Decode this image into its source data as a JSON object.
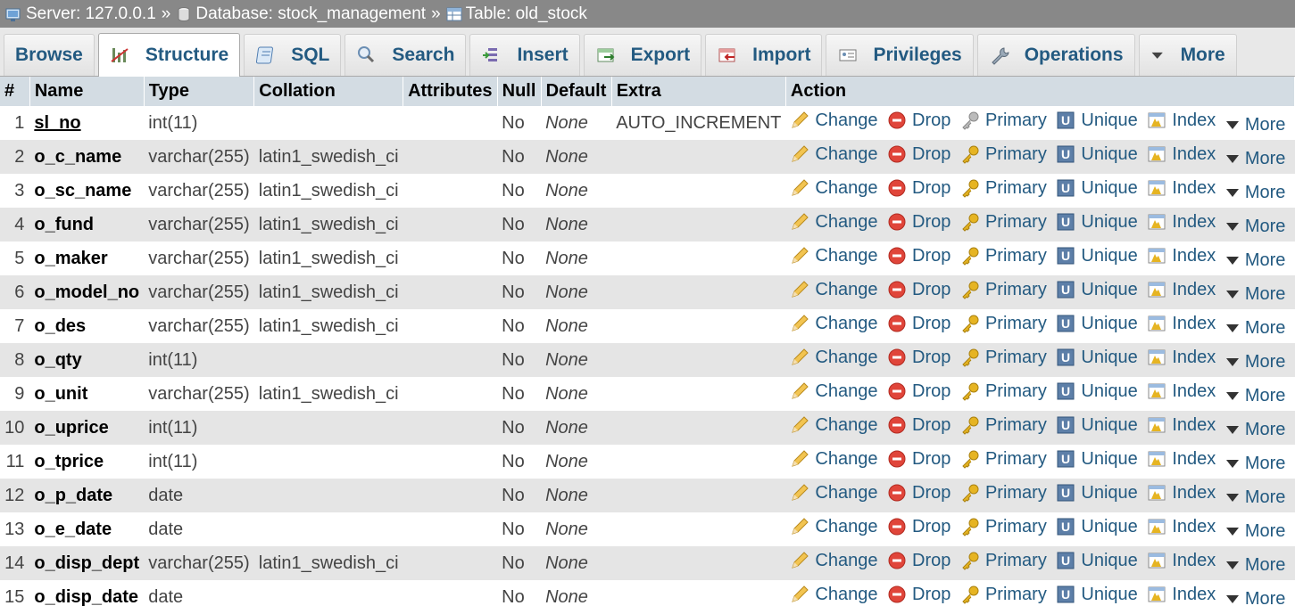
{
  "breadcrumb": {
    "server": "Server: 127.0.0.1",
    "database": "Database: stock_management",
    "table": "Table: old_stock",
    "separator": "»"
  },
  "tabs": [
    {
      "label": "Browse",
      "icon": "browse-icon"
    },
    {
      "label": "Structure",
      "icon": "structure-icon"
    },
    {
      "label": "SQL",
      "icon": "sql-icon"
    },
    {
      "label": "Search",
      "icon": "search-icon"
    },
    {
      "label": "Insert",
      "icon": "insert-icon"
    },
    {
      "label": "Export",
      "icon": "export-icon"
    },
    {
      "label": "Import",
      "icon": "import-icon"
    },
    {
      "label": "Privileges",
      "icon": "privileges-icon"
    },
    {
      "label": "Operations",
      "icon": "wrench-icon"
    },
    {
      "label": "More",
      "icon": "dropdown-icon"
    }
  ],
  "active_tab": "Structure",
  "columns": [
    "#",
    "Name",
    "Type",
    "Collation",
    "Attributes",
    "Null",
    "Default",
    "Extra",
    "Action"
  ],
  "actions": {
    "change": "Change",
    "drop": "Drop",
    "primary": "Primary",
    "unique": "Unique",
    "index": "Index",
    "more": "More"
  },
  "rows": [
    {
      "num": "1",
      "name": "sl_no",
      "type": "int(11)",
      "collation": "",
      "attributes": "",
      "null": "No",
      "default": "None",
      "extra": "AUTO_INCREMENT"
    },
    {
      "num": "2",
      "name": "o_c_name",
      "type": "varchar(255)",
      "collation": "latin1_swedish_ci",
      "attributes": "",
      "null": "No",
      "default": "None",
      "extra": ""
    },
    {
      "num": "3",
      "name": "o_sc_name",
      "type": "varchar(255)",
      "collation": "latin1_swedish_ci",
      "attributes": "",
      "null": "No",
      "default": "None",
      "extra": ""
    },
    {
      "num": "4",
      "name": "o_fund",
      "type": "varchar(255)",
      "collation": "latin1_swedish_ci",
      "attributes": "",
      "null": "No",
      "default": "None",
      "extra": ""
    },
    {
      "num": "5",
      "name": "o_maker",
      "type": "varchar(255)",
      "collation": "latin1_swedish_ci",
      "attributes": "",
      "null": "No",
      "default": "None",
      "extra": ""
    },
    {
      "num": "6",
      "name": "o_model_no",
      "type": "varchar(255)",
      "collation": "latin1_swedish_ci",
      "attributes": "",
      "null": "No",
      "default": "None",
      "extra": ""
    },
    {
      "num": "7",
      "name": "o_des",
      "type": "varchar(255)",
      "collation": "latin1_swedish_ci",
      "attributes": "",
      "null": "No",
      "default": "None",
      "extra": ""
    },
    {
      "num": "8",
      "name": "o_qty",
      "type": "int(11)",
      "collation": "",
      "attributes": "",
      "null": "No",
      "default": "None",
      "extra": ""
    },
    {
      "num": "9",
      "name": "o_unit",
      "type": "varchar(255)",
      "collation": "latin1_swedish_ci",
      "attributes": "",
      "null": "No",
      "default": "None",
      "extra": ""
    },
    {
      "num": "10",
      "name": "o_uprice",
      "type": "int(11)",
      "collation": "",
      "attributes": "",
      "null": "No",
      "default": "None",
      "extra": ""
    },
    {
      "num": "11",
      "name": "o_tprice",
      "type": "int(11)",
      "collation": "",
      "attributes": "",
      "null": "No",
      "default": "None",
      "extra": ""
    },
    {
      "num": "12",
      "name": "o_p_date",
      "type": "date",
      "collation": "",
      "attributes": "",
      "null": "No",
      "default": "None",
      "extra": ""
    },
    {
      "num": "13",
      "name": "o_e_date",
      "type": "date",
      "collation": "",
      "attributes": "",
      "null": "No",
      "default": "None",
      "extra": ""
    },
    {
      "num": "14",
      "name": "o_disp_dept",
      "type": "varchar(255)",
      "collation": "latin1_swedish_ci",
      "attributes": "",
      "null": "No",
      "default": "None",
      "extra": ""
    },
    {
      "num": "15",
      "name": "o_disp_date",
      "type": "date",
      "collation": "",
      "attributes": "",
      "null": "No",
      "default": "None",
      "extra": ""
    }
  ],
  "primary_key_row": "1",
  "colors": {
    "link": "#235a81",
    "header_bg": "#d3dce3",
    "row_alt": "#e5e5e5",
    "breadcrumb_bg": "#888888",
    "drop_red": "#e0453a",
    "key_gold": "#e6b422"
  }
}
